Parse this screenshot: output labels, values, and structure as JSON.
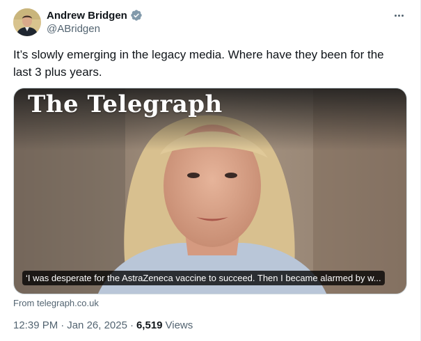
{
  "author": {
    "display_name": "Andrew Bridgen",
    "handle": "@ABridgen",
    "verified_icon": "verified-badge-icon",
    "avatar_icon": "profile-avatar"
  },
  "tweet": {
    "text": "It’s slowly emerging in the legacy media. Where have they been for the last 3 plus years."
  },
  "card": {
    "masthead": "The Telegraph",
    "caption": "‘I was desperate for the AstraZeneca vaccine to succeed. Then I became alarmed by w...",
    "from_prefix": "From ",
    "from_domain": "telegraph.co.uk"
  },
  "meta": {
    "time": "12:39 PM",
    "separator_1": "·",
    "date": "Jan 26, 2025",
    "separator_2": "·",
    "views_count": "6,519",
    "views_label": "Views"
  },
  "colors": {
    "text_primary": "#0f1419",
    "text_secondary": "#536471",
    "verified_blue": "#1d9bf0",
    "border": "#cfd9de"
  }
}
